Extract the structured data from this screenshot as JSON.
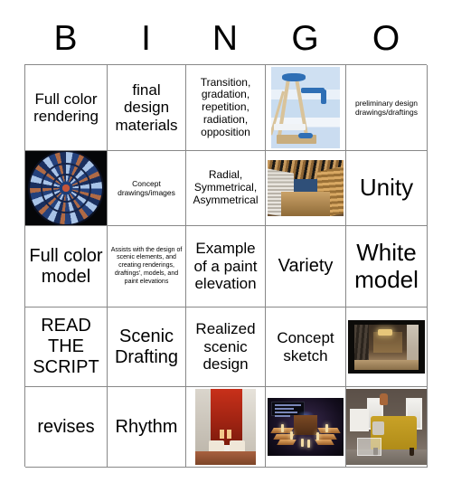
{
  "card": {
    "title": "BINGO",
    "header_letters": [
      "B",
      "I",
      "N",
      "G",
      "O"
    ],
    "rows": 5,
    "columns": 5,
    "border_color": "#888888",
    "background_color": "#ffffff",
    "text_color": "#000000"
  },
  "cells": [
    [
      {
        "kind": "text",
        "text": "Full color rendering",
        "size": "md"
      },
      {
        "kind": "text",
        "text": "final design materials",
        "size": "md"
      },
      {
        "kind": "text",
        "text": "Transition, gradation, repetition, radiation, opposition",
        "size": "sm"
      },
      {
        "kind": "image",
        "image_name": "easel-blue-wall-photo",
        "alt": "wooden easel against blue striped wall"
      },
      {
        "kind": "text",
        "text": "preliminary design drawings/draftings",
        "size": "xs"
      }
    ],
    [
      {
        "kind": "image",
        "image_name": "rose-window-photo",
        "alt": "stained glass rose window"
      },
      {
        "kind": "text",
        "text": "Concept drawings/images",
        "size": "xs"
      },
      {
        "kind": "text",
        "text": "Radial, Symmetrical, Asymmetrical",
        "size": "sm"
      },
      {
        "kind": "image",
        "image_name": "concert-hall-interior-photo",
        "alt": "wooden concert hall interior"
      },
      {
        "kind": "text",
        "text": "Unity",
        "size": "xl"
      }
    ],
    [
      {
        "kind": "text",
        "text": "Full color model",
        "size": "lg"
      },
      {
        "kind": "text",
        "text": "Assists with the design of scenic elements, and creating renderings, draftings', models, and paint elevations",
        "size": "xxs"
      },
      {
        "kind": "text",
        "text": "Example of a paint elevation",
        "size": "md"
      },
      {
        "kind": "text",
        "text": "Variety",
        "size": "lg"
      },
      {
        "kind": "text",
        "text": "White model",
        "size": "xl"
      }
    ],
    [
      {
        "kind": "text",
        "text": "READ THE SCRIPT",
        "size": "lg"
      },
      {
        "kind": "text",
        "text": "Scenic Drafting",
        "size": "lg"
      },
      {
        "kind": "text",
        "text": "Realized scenic design",
        "size": "md"
      },
      {
        "kind": "text",
        "text": "Concept sketch",
        "size": "md"
      },
      {
        "kind": "image",
        "image_name": "stage-set-interior-photo",
        "alt": "dark stage set interior room"
      }
    ],
    [
      {
        "kind": "text",
        "text": "revises",
        "size": "lg"
      },
      {
        "kind": "text",
        "text": "Rhythm",
        "size": "lg"
      },
      {
        "kind": "image",
        "image_name": "red-wall-lounge-photo",
        "alt": "lounge with tall red wall"
      },
      {
        "kind": "image",
        "image_name": "stage-rendering-photo",
        "alt": "dark 3D stage rendering with platforms and candles"
      },
      {
        "kind": "image",
        "image_name": "gold-sofa-living-room-photo",
        "alt": "living room with gold sofa"
      }
    ]
  ]
}
